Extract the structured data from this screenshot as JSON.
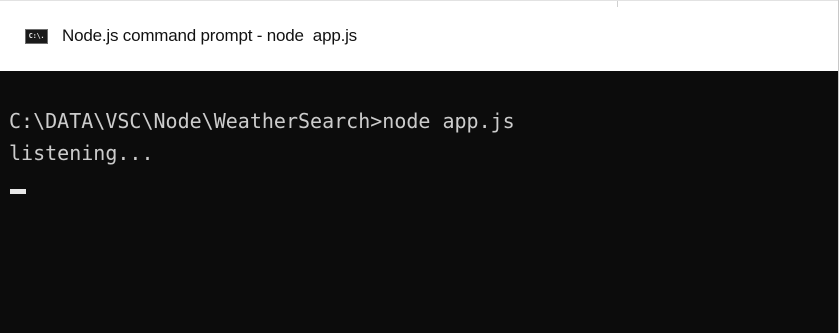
{
  "window": {
    "title": "Node.js command prompt - node  app.js",
    "icon": {
      "name": "console-window-icon",
      "label": "C:\\."
    }
  },
  "console": {
    "lines": [
      "C:\\DATA\\VSC\\Node\\WeatherSearch>node app.js",
      "listening..."
    ],
    "cursor": "blinking-underscore-cursor"
  },
  "colors": {
    "console_background": "#0c0c0c",
    "console_text": "#cccccc",
    "titlebar_background": "#ffffff",
    "title_text": "#111111"
  }
}
